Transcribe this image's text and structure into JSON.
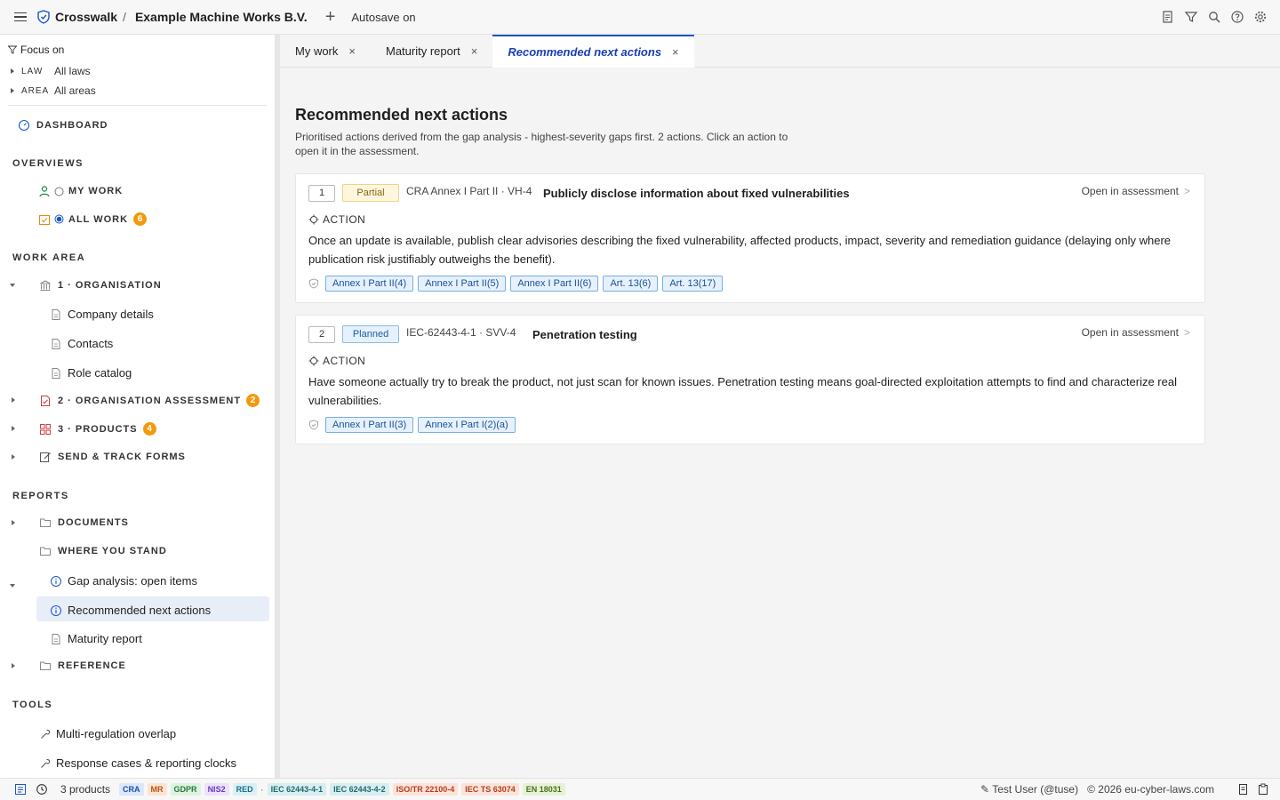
{
  "topbar": {
    "brand": "Crosswalk",
    "separator": "/",
    "organisation": "Example Machine Works B.V.",
    "add_label": "+",
    "autosave": "Autosave on",
    "icons": [
      "report-icon",
      "filter-icon",
      "search-icon",
      "help-icon",
      "gear-icon"
    ]
  },
  "sidebar": {
    "focus_on": "Focus on",
    "filters": [
      {
        "key": "LAW",
        "value": "All laws"
      },
      {
        "key": "AREA",
        "value": "All areas"
      }
    ],
    "dashboard": "DASHBOARD",
    "overviews_head": "OVERVIEWS",
    "my_work": "MY WORK",
    "all_work": "ALL WORK",
    "all_work_count": "6",
    "work_area_head": "WORK AREA",
    "organisation": "1 · ORGANISATION",
    "company_details": "Company details",
    "contacts": "Contacts",
    "role_catalog": "Role catalog",
    "org_assessment": "2 · ORGANISATION ASSESSMENT",
    "org_assessment_count": "2",
    "products": "3 · PRODUCTS",
    "products_count": "4",
    "send_track": "SEND & TRACK FORMS",
    "reports_head": "REPORTS",
    "documents": "DOCUMENTS",
    "where_you_stand": "WHERE YOU STAND",
    "gap_analysis": "Gap analysis: open items",
    "recommended": "Recommended next actions",
    "maturity": "Maturity report",
    "reference": "REFERENCE",
    "tools_head": "TOOLS",
    "multi_reg": "Multi-regulation overlap",
    "response_cases": "Response cases & reporting clocks"
  },
  "tabs": [
    {
      "label": "My work",
      "close": "×"
    },
    {
      "label": "Maturity report",
      "close": "×"
    },
    {
      "label": "Recommended next actions",
      "close": "×"
    }
  ],
  "main": {
    "title": "Recommended next actions",
    "subtitle": "Prioritised actions derived from the gap analysis - highest-severity gaps first. 2 actions. Click an action to open it in the assessment.",
    "action_label": "ACTION",
    "open_label": "Open in assessment",
    "actions": [
      {
        "num": "1",
        "status": "Partial",
        "ref": "CRA Annex I Part II · VH-4",
        "title": "Publicly disclose information about fixed vulnerabilities",
        "desc": "Once an update is available, publish clear advisories describing the fixed vulnerability, affected products, impact, severity and remediation guidance (delaying only where publication risk justifiably outweighs the benefit).",
        "chips": [
          "Annex I Part II(4)",
          "Annex I Part II(5)",
          "Annex I Part II(6)",
          "Art. 13(6)",
          "Art. 13(17)"
        ]
      },
      {
        "num": "2",
        "status": "Planned",
        "ref": "IEC-62443-4-1 · SVV-4",
        "title": "Penetration testing",
        "desc": "Have someone actually try to break the product, not just scan for known issues. Penetration testing means goal-directed exploitation attempts to find and characterize real vulnerabilities.",
        "chips": [
          "Annex I Part II(3)",
          "Annex I Part I(2)(a)"
        ]
      }
    ]
  },
  "statusbar": {
    "products": "3 products",
    "dot": "·",
    "tags": [
      {
        "label": "CRA",
        "bg": "#dbe7fb",
        "fg": "#1d4fa8"
      },
      {
        "label": "MR",
        "bg": "#fde4d2",
        "fg": "#b2541a"
      },
      {
        "label": "GDPR",
        "bg": "#dcf3e0",
        "fg": "#2a7a3a"
      },
      {
        "label": "NIS2",
        "bg": "#ece2fb",
        "fg": "#6a3bb8"
      },
      {
        "label": "RED",
        "bg": "#d9f0f7",
        "fg": "#1b6d88"
      },
      {
        "label": "IEC 62443-4-1",
        "bg": "#d8eef0",
        "fg": "#1f6a70"
      },
      {
        "label": "IEC 62443-4-2",
        "bg": "#d8eef0",
        "fg": "#1f6a70"
      },
      {
        "label": "ISO/TR 22100-4",
        "bg": "#fde2d9",
        "fg": "#b23f1a"
      },
      {
        "label": "IEC TS 63074",
        "bg": "#fde2d9",
        "fg": "#b23f1a"
      },
      {
        "label": "EN 18031",
        "bg": "#e6f1d5",
        "fg": "#4d6e1c"
      }
    ],
    "user": "✎ Test User (@tuse)",
    "copyright": "© 2026 eu-cyber-laws.com"
  }
}
